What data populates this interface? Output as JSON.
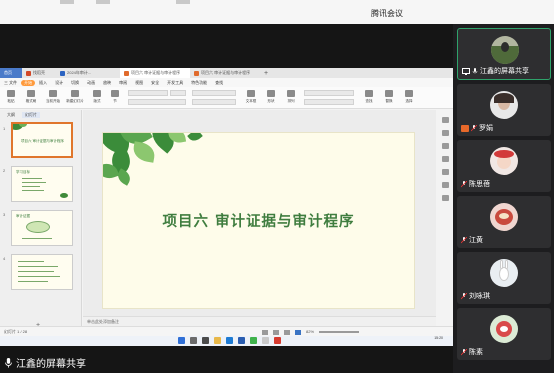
{
  "meeting": {
    "app_title": "腾讯会议",
    "share_label": "江鑫的屏幕共享"
  },
  "wps": {
    "tabs": [
      {
        "label": "首页"
      },
      {
        "label": "找稻壳"
      },
      {
        "label": "2024年审计..."
      },
      {
        "label": "项目六 审计证据与审计程序"
      },
      {
        "label": "项目六 审计证据与审计程序"
      }
    ],
    "menu": [
      "三 文件",
      "开始",
      "插入",
      "设计",
      "切换",
      "动画",
      "放映",
      "审阅",
      "视图",
      "安全",
      "开发工具",
      "特色功能",
      "查找"
    ],
    "toolbar": [
      {
        "label": "粘贴"
      },
      {
        "label": "格式刷"
      },
      {
        "label": "当前开始"
      },
      {
        "label": "新建幻灯片"
      },
      {
        "label": "版式"
      },
      {
        "label": "节"
      },
      {
        "label": "文本框"
      },
      {
        "label": "形状"
      },
      {
        "label": "排列"
      },
      {
        "label": "查找"
      },
      {
        "label": "替换"
      },
      {
        "label": "选择"
      }
    ],
    "thumb_tabs": [
      "大纲",
      "幻灯片"
    ],
    "slides": [
      {
        "num": "1",
        "text": "项目六  审计证据与审计程序"
      },
      {
        "num": "2",
        "text": "学习目标"
      },
      {
        "num": "3",
        "text": "审计证据"
      },
      {
        "num": "4",
        "text": "..."
      }
    ],
    "slide_title": "项目六   审计证据与审计程序",
    "notes_placeholder": "单击此处添加备注",
    "status_left": "幻灯片 1 / 28",
    "zoom": "82%",
    "clock": "15:20"
  },
  "participants": [
    {
      "name": "江鑫的屏幕共享",
      "highlight": true
    },
    {
      "name": "罗娟"
    },
    {
      "name": "陈思蓓"
    },
    {
      "name": "江黄"
    },
    {
      "name": "刘咏琪"
    },
    {
      "name": "陈素"
    }
  ],
  "colors": {
    "slide_title": "#3f7d3f",
    "slide_bg": "#fefcea",
    "highlight_border": "#2fa36b",
    "panel_bg": "#1d1d1f"
  }
}
